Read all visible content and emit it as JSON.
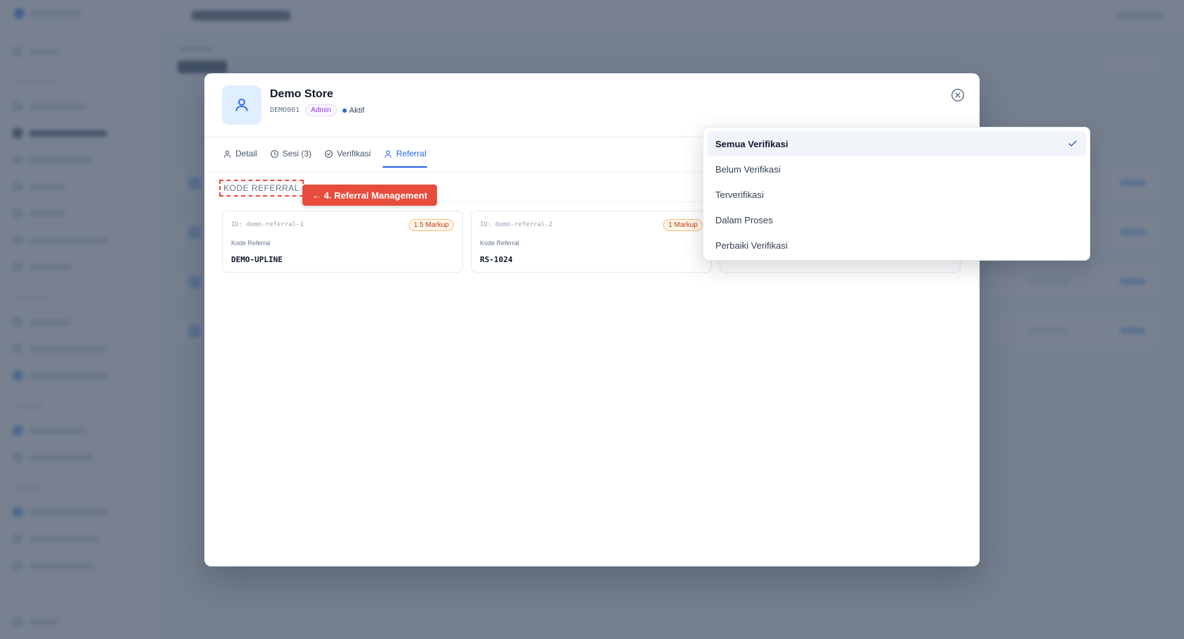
{
  "modal": {
    "name": "Demo Store",
    "code": "DEMO001",
    "role": "Admin",
    "status": "Aktif",
    "tabs": [
      {
        "label": "Detail",
        "icon": "user-icon"
      },
      {
        "label": "Sesi (3)",
        "icon": "clock-icon"
      },
      {
        "label": "Verifikasi",
        "icon": "check-circle-icon"
      },
      {
        "label": "Referral",
        "icon": "user-icon",
        "active": true
      }
    ],
    "section_label": "KODE REFERRAL",
    "callout": "← 4. Referral Management",
    "referrals": [
      {
        "id": "ID: demo-referral-1",
        "badge": "1.5 Markup",
        "label": "Kode Referral",
        "code": "DEMO-UPLINE"
      },
      {
        "id": "ID: demo-referral-2",
        "badge": "1 Markup",
        "label": "Kode Referral",
        "code": "RS-1024"
      }
    ]
  },
  "dropdown": {
    "options": [
      {
        "label": "Semua Verifikasi",
        "selected": true
      },
      {
        "label": "Belum Verifikasi"
      },
      {
        "label": "Terverifikasi"
      },
      {
        "label": "Dalam Proses"
      },
      {
        "label": "Perbaiki Verifikasi"
      }
    ]
  },
  "colors": {
    "accent": "#2563eb",
    "callout": "#e74c3c",
    "badge_text": "#c2410c",
    "role_text": "#9333ea",
    "overlay": "#475569"
  }
}
